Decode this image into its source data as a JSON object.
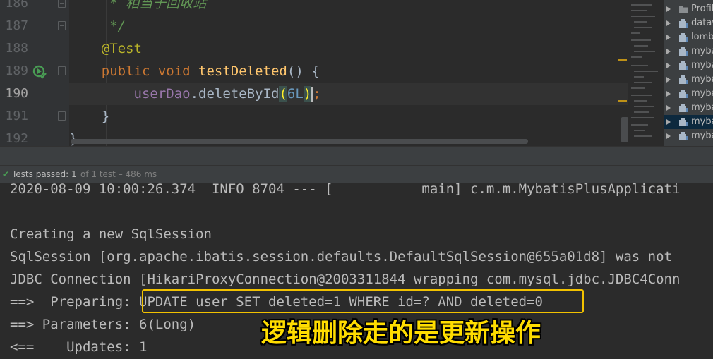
{
  "editor": {
    "lines": [
      {
        "number": "186",
        "tokens": [
          {
            "t": "     * ",
            "c": "t-com"
          },
          {
            "t": "相当于回收站",
            "c": "t-com"
          }
        ]
      },
      {
        "number": "187",
        "tokens": [
          {
            "t": "     */",
            "c": "t-com"
          }
        ]
      },
      {
        "number": "188",
        "tokens": [
          {
            "t": "    ",
            "c": ""
          },
          {
            "t": "@Test",
            "c": "t-ann"
          }
        ]
      },
      {
        "number": "189",
        "tokens": [
          {
            "t": "    ",
            "c": ""
          },
          {
            "t": "public ",
            "c": "t-kw"
          },
          {
            "t": "void ",
            "c": "t-kw"
          },
          {
            "t": "testDeleted",
            "c": "t-fn"
          },
          {
            "t": "() {",
            "c": "t-br"
          }
        ]
      },
      {
        "number": "190",
        "tokens": [
          {
            "t": "        ",
            "c": ""
          },
          {
            "t": "userDao",
            "c": "t-fld"
          },
          {
            "t": ".deleteById",
            "c": ""
          },
          {
            "t": "(",
            "c": "t-hl"
          },
          {
            "t": "6L",
            "c": "t-num"
          },
          {
            "t": ")",
            "c": "t-hl"
          },
          {
            "t": ";",
            "c": "t-kw"
          }
        ]
      },
      {
        "number": "191",
        "tokens": [
          {
            "t": "    }",
            "c": "t-br"
          }
        ]
      },
      {
        "number": "192",
        "tokens": [
          {
            "t": "}",
            "c": "t-br"
          }
        ]
      }
    ],
    "current_line": "190",
    "run_icon": "run-test-icon"
  },
  "structure_panel": {
    "items": [
      {
        "label": "Profil",
        "icon": "folder-icon"
      },
      {
        "label": "dataw",
        "icon": "maven-module-icon"
      },
      {
        "label": "lomb",
        "icon": "maven-module-icon"
      },
      {
        "label": "myba",
        "icon": "maven-module-icon"
      },
      {
        "label": "myba",
        "icon": "maven-module-icon"
      },
      {
        "label": "myba",
        "icon": "maven-module-icon"
      },
      {
        "label": "myba",
        "icon": "maven-module-icon"
      },
      {
        "label": "myba",
        "icon": "maven-module-icon"
      },
      {
        "label": "myba",
        "icon": "maven-module-icon",
        "selected": true
      },
      {
        "label": "myba",
        "icon": "maven-module-icon"
      }
    ]
  },
  "tests_bar": {
    "status_icon": "check-icon",
    "passed": "Tests passed: 1",
    "total": "of 1 test – 486 ms",
    "status_color": "#499c54"
  },
  "console": {
    "lines": [
      "2020-08-09 10:00:26.374  INFO 8704 --- [           main] c.m.m.MybatisPlusApplicati",
      "",
      "Creating a new SqlSession",
      "SqlSession [org.apache.ibatis.session.defaults.DefaultSqlSession@655a01d8] was not",
      "JDBC Connection [HikariProxyConnection@2003311844 wrapping com.mysql.jdbc.JDBC4Conn",
      "==>  Preparing: UPDATE user SET deleted=1 WHERE id=? AND deleted=0",
      "==> Parameters: 6(Long)",
      "<==    Updates: 1"
    ],
    "highlight_color": "#f2c200"
  },
  "overlay_caption": "逻辑删除走的是更新操作"
}
